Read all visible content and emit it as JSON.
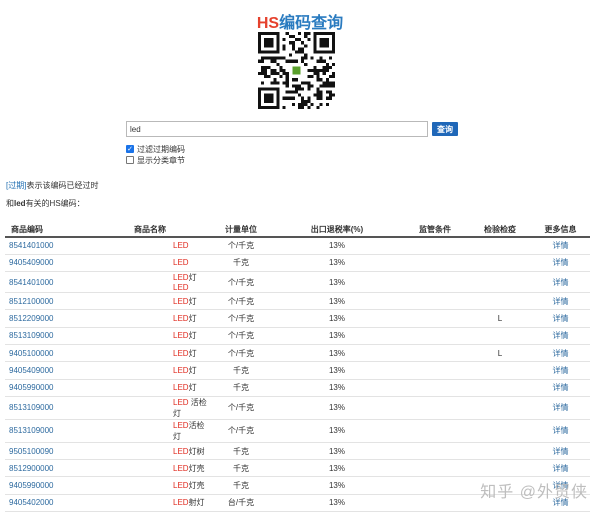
{
  "header": {
    "title_hs": "HS",
    "title_rest": "编码查询",
    "qr_alt": "QR code"
  },
  "search": {
    "value": "led",
    "button_label": "查询"
  },
  "options": [
    {
      "label": "过滤过期编码",
      "checked": true
    },
    {
      "label": "显示分类章节",
      "checked": false
    }
  ],
  "notice": {
    "tag": "[过期]",
    "text": "表示该编码已经过时"
  },
  "related": {
    "prefix": "和",
    "keyword": "led",
    "suffix": "有关的HS编码："
  },
  "table": {
    "headers": [
      "商品编码",
      "商品名称",
      "计量单位",
      "出口退税率(%)",
      "监管条件",
      "检验检疫",
      "更多信息"
    ],
    "rows": [
      {
        "code": "8541401000",
        "name_red": "LED",
        "name_rest": "",
        "unit": "个/千克",
        "rate": "13%",
        "supervision": "",
        "inspection": "",
        "more": "详情"
      },
      {
        "code": "9405409000",
        "name_red": "LED",
        "name_rest": "",
        "unit": "千克",
        "rate": "13%",
        "supervision": "",
        "inspection": "",
        "more": "详情"
      },
      {
        "code": "8541401000",
        "name_red": "LED",
        "name_rest": "灯",
        "name_red2": "LED",
        "unit": "个/千克",
        "rate": "13%",
        "supervision": "",
        "inspection": "",
        "more": "详情"
      },
      {
        "code": "8512100000",
        "name_red": "LED",
        "name_rest": "灯",
        "unit": "个/千克",
        "rate": "13%",
        "supervision": "",
        "inspection": "",
        "more": "详情"
      },
      {
        "code": "8512209000",
        "name_red": "LED",
        "name_rest": "灯",
        "unit": "个/千克",
        "rate": "13%",
        "supervision": "",
        "inspection": "L",
        "more": "详情"
      },
      {
        "code": "8513109000",
        "name_red": "LED",
        "name_rest": "灯",
        "unit": "个/千克",
        "rate": "13%",
        "supervision": "",
        "inspection": "",
        "more": "详情"
      },
      {
        "code": "9405100000",
        "name_red": "LED",
        "name_rest": "灯",
        "unit": "个/千克",
        "rate": "13%",
        "supervision": "",
        "inspection": "L",
        "more": "详情"
      },
      {
        "code": "9405409000",
        "name_red": "LED",
        "name_rest": "灯",
        "unit": "千克",
        "rate": "13%",
        "supervision": "",
        "inspection": "",
        "more": "详情"
      },
      {
        "code": "9405990000",
        "name_red": "LED",
        "name_rest": "灯",
        "unit": "千克",
        "rate": "13%",
        "supervision": "",
        "inspection": "",
        "more": "详情"
      },
      {
        "code": "8513109000",
        "name_red": "LED",
        "name_rest": " 活检灯",
        "unit": "个/千克",
        "rate": "13%",
        "supervision": "",
        "inspection": "",
        "more": "详情"
      },
      {
        "code": "8513109000",
        "name_red": "LED",
        "name_rest": "活检灯",
        "unit": "个/千克",
        "rate": "13%",
        "supervision": "",
        "inspection": "",
        "more": "详情"
      },
      {
        "code": "9505100090",
        "name_red": "LED",
        "name_rest": "灯树",
        "unit": "千克",
        "rate": "13%",
        "supervision": "",
        "inspection": "",
        "more": "详情"
      },
      {
        "code": "8512900000",
        "name_red": "LED",
        "name_rest": "灯壳",
        "unit": "千克",
        "rate": "13%",
        "supervision": "",
        "inspection": "",
        "more": "详情"
      },
      {
        "code": "9405990000",
        "name_red": "LED",
        "name_rest": "灯壳",
        "unit": "千克",
        "rate": "13%",
        "supervision": "",
        "inspection": "",
        "more": "详情"
      },
      {
        "code": "9405402000",
        "name_red": "LED",
        "name_rest": "射灯",
        "unit": "台/千克",
        "rate": "13%",
        "supervision": "",
        "inspection": "",
        "more": "详情"
      },
      {
        "code": "9405409000",
        "name_red": "LED",
        "name_rest": "射灯",
        "unit": "千克",
        "rate": "13%",
        "supervision": "",
        "inspection": "",
        "more": "详情"
      }
    ]
  },
  "watermark": "知乎 @外贸侠",
  "colors": {
    "title_blue": "#2a7bc0",
    "title_red": "#e5412d",
    "link_blue": "#2d6a9f",
    "button_blue": "#1f67b8",
    "keyword_red": "#e02b20"
  }
}
